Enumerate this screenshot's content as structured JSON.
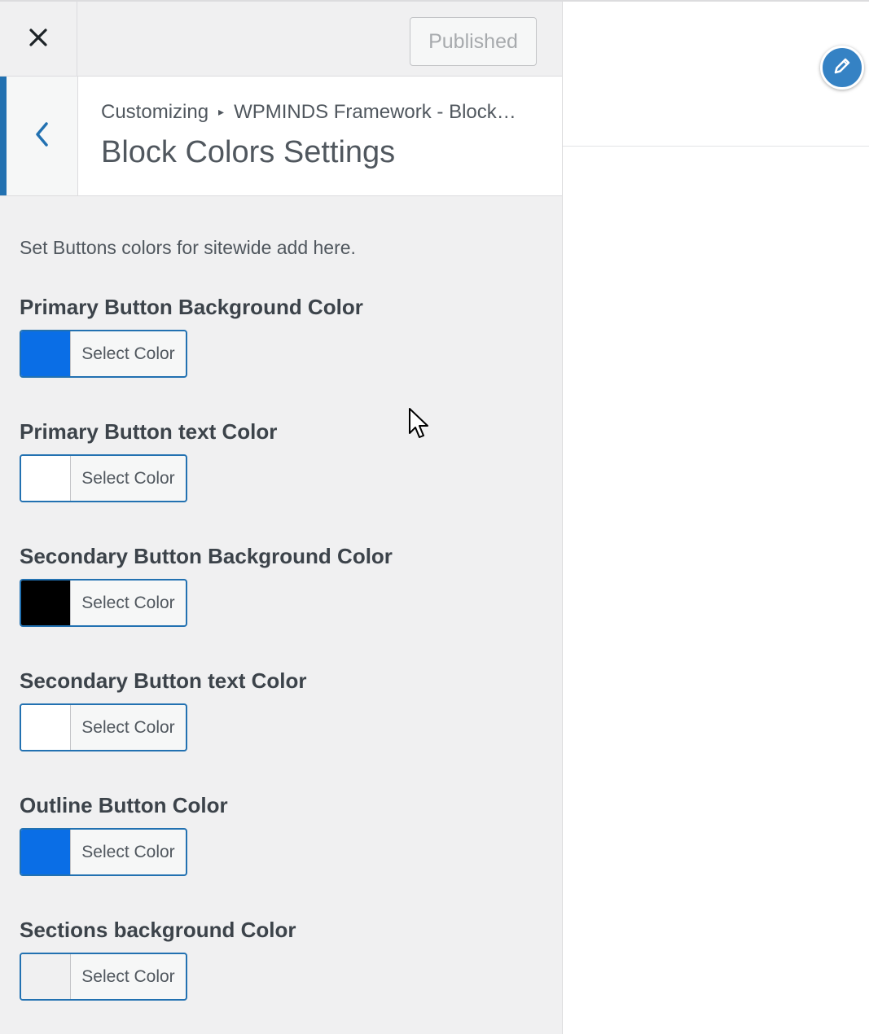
{
  "header": {
    "close_icon": "close-icon",
    "publish_label": "Published"
  },
  "section": {
    "back_icon": "chevron-left-icon",
    "breadcrumb_root": "Customizing",
    "breadcrumb_sep": "▸",
    "breadcrumb_panel": "WPMINDS Framework - Block…",
    "title": "Block Colors Settings"
  },
  "description": "Set Buttons colors for sitewide add here.",
  "controls": [
    {
      "label": "Primary Button Background Color",
      "button_label": "Select Color",
      "color": "#0a6ee6"
    },
    {
      "label": "Primary Button text Color",
      "button_label": "Select Color",
      "color": "#ffffff"
    },
    {
      "label": "Secondary Button Background Color",
      "button_label": "Select Color",
      "color": "#000000"
    },
    {
      "label": "Secondary Button text Color",
      "button_label": "Select Color",
      "color": "#ffffff"
    },
    {
      "label": "Outline Button Color",
      "button_label": "Select Color",
      "color": "#0a6ee6"
    },
    {
      "label": "Sections background Color",
      "button_label": "Select Color",
      "color": "#f0f0f1"
    }
  ],
  "preview": {
    "edit_icon": "pencil-icon"
  },
  "colors": {
    "accent": "#2271b1",
    "sidebar_bg": "#f0f0f1",
    "shortcut_bg": "#3582c4"
  }
}
